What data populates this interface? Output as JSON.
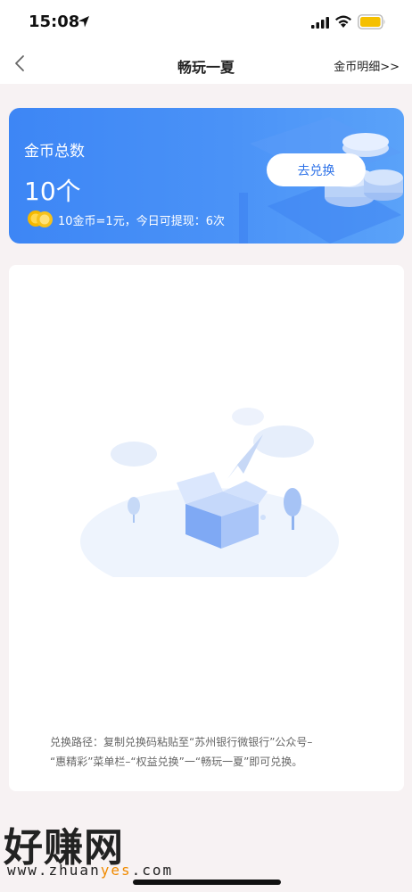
{
  "status_bar": {
    "time": "15:08",
    "icons": [
      "location-arrow-icon",
      "signal-icon",
      "wifi-icon",
      "battery-icon"
    ],
    "battery_color": "#f5c000"
  },
  "nav": {
    "title": "畅玩一夏",
    "right_link": "金币明细>>",
    "back_icon": "chevron-left-icon"
  },
  "coin_card": {
    "label": "金币总数",
    "total": "10个",
    "rate_text": "10金币=1元，今日可提现：6次",
    "exchange_button": "去兑换",
    "coin_icon": "coin-icon",
    "accent_color": "#3d86f5"
  },
  "content": {
    "illustration": "empty-box-illustration",
    "exchange_path_line1": "兑换路径：复制兑换码粘贴至“苏州银行微银行”公众号–",
    "exchange_path_line2": "“惠精彩”菜单栏–“权益兑换”一“畅玩一夏”即可兑换。"
  },
  "watermark": {
    "logo_text": "好赚网",
    "url_prefix": "www.zhuan",
    "url_accent": "yes",
    "url_suffix": ".com",
    "accent_color": "#f08a00"
  }
}
